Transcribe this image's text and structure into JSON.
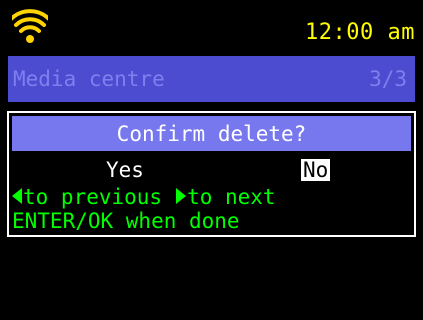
{
  "status_bar": {
    "wifi_icon": "wifi-icon",
    "time": "12:00 am"
  },
  "menu": {
    "title": "Media centre",
    "position": "3/3"
  },
  "dialog": {
    "title": "Confirm delete?",
    "options": {
      "yes": "Yes",
      "no": "No",
      "selected": "No"
    },
    "hints": {
      "previous": "to previous",
      "next": "to next",
      "enter": "ENTER/OK when done"
    }
  },
  "colors": {
    "background": "#000000",
    "clock": "#ffff00",
    "menu_bar": "#4c4cd0",
    "menu_text": "#7f7ff0",
    "dialog_header": "#7878ee",
    "hint_text": "#00ff00",
    "wifi": "#ffd400"
  }
}
